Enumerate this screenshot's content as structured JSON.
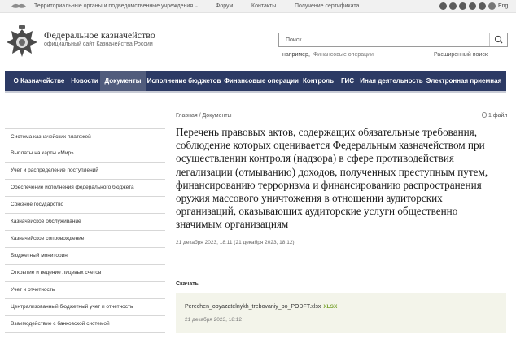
{
  "topbar": {
    "regional_label": "Территориальные органы и подведомственные учреждения",
    "caret": "⌄",
    "forum": "Форум",
    "contacts": "Контакты",
    "certificate": "Получение сертификата",
    "social_icons": [
      "telegram-icon",
      "vk-icon",
      "youtube-icon",
      "ok-icon",
      "rss-icon",
      "eye-icon"
    ],
    "lang": "Eng"
  },
  "header": {
    "title": "Федеральное казначейство",
    "subtitle": "официальный сайт Казначейства России"
  },
  "search": {
    "placeholder": "Поиск",
    "hint_prefix": "например,",
    "hint_example": "Финансовые операции",
    "advanced": "Расширенный поиск"
  },
  "nav": {
    "items": [
      {
        "label": "О Казначействе",
        "active": false
      },
      {
        "label": "Новости",
        "active": false
      },
      {
        "label": "Документы",
        "active": true
      },
      {
        "label": "Исполнение бюджетов",
        "active": false
      },
      {
        "label": "Финансовые операции",
        "active": false
      },
      {
        "label": "Контроль",
        "active": false
      },
      {
        "label": "ГИС",
        "active": false
      },
      {
        "label": "Иная деятельность",
        "active": false
      },
      {
        "label": "Электронная приемная",
        "active": false
      }
    ]
  },
  "sidebar": {
    "items": [
      "Система казначейских платежей",
      "Выплаты на карты «Мир»",
      "Учет и распределение поступлений",
      "Обеспечение исполнения федерального бюджета",
      "Союзное государство",
      "Казначейское обслуживание",
      "Казначейское сопровождение",
      "Бюджетный мониторинг",
      "Открытие и ведение лицевых счетов",
      "Учет и отчетность",
      "Централизованный бюджетный учет и отчетность",
      "Взаимодействие с банковской системой"
    ]
  },
  "content": {
    "breadcrumb": "Главная / Документы",
    "files_count": "1 файл",
    "title": "Перечень правовых актов, содержащих обязательные требования, соблюдение которых оценивается Федеральным казначейством при осуществлении контроля (надзора) в сфере противодействия легализации (отмыванию) доходов, полученных преступным путем, финансированию терроризма и финансированию распространения оружия массового уничтожения в отношении аудиторских организаций, оказывающих аудиторские услуги общественно значимым организациям",
    "date": "21 декабря 2023, 18:11 (21 декабря 2023, 18:12)",
    "download_label": "Скачать",
    "file": {
      "name": "Perechen_obyazatelnykh_trebovaniy_po_PODFT.xlsx",
      "ext": "XLSX",
      "date": "21 декабря 2023, 18:12"
    }
  },
  "colors": {
    "nav_bg": "#2c3a64",
    "nav_active": "#515c7c",
    "file_card_bg": "#f3f4ea",
    "ext_green": "#78a22f"
  }
}
